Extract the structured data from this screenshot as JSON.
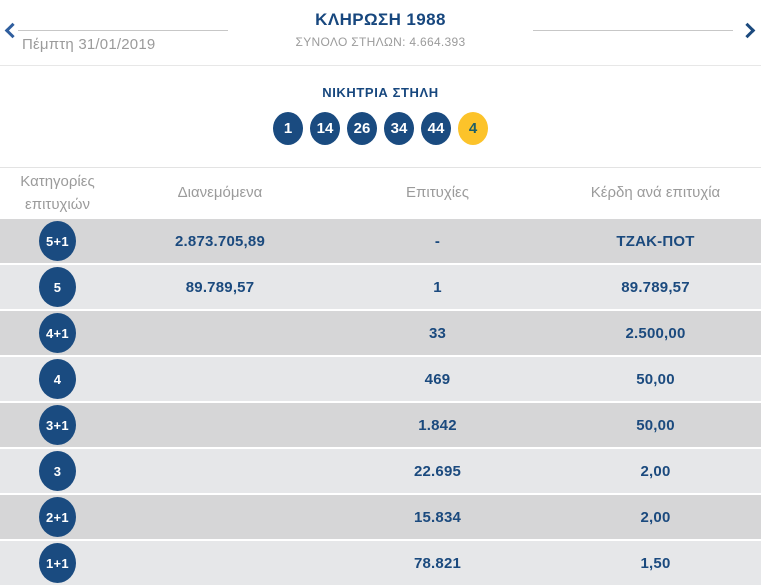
{
  "header": {
    "title": "ΚΛΗΡΩΣΗ 1988",
    "total_columns": "ΣΥΝΟΛΟ ΣΤΗΛΩΝ: 4.664.393",
    "date": "Πέμπτη 31/01/2019",
    "prev_icon": "chevron-left",
    "next_icon": "chevron-right"
  },
  "winning_column": {
    "title": "ΝΙΚΗΤΡΙΑ ΣΤΗΛΗ",
    "numbers": [
      "1",
      "14",
      "26",
      "34",
      "44"
    ],
    "joker": "4"
  },
  "results_table": {
    "columns": [
      "Κατηγορίες επιτυχιών",
      "Διανεμόμενα",
      "Επιτυχίες",
      "Κέρδη ανά επιτυχία"
    ],
    "rows": [
      {
        "category": "5+1",
        "distributed": "2.873.705,89",
        "winners": "-",
        "prize": "ΤΖΑΚ-ΠΟΤ"
      },
      {
        "category": "5",
        "distributed": "89.789,57",
        "winners": "1",
        "prize": "89.789,57"
      },
      {
        "category": "4+1",
        "distributed": "",
        "winners": "33",
        "prize": "2.500,00"
      },
      {
        "category": "4",
        "distributed": "",
        "winners": "469",
        "prize": "50,00"
      },
      {
        "category": "3+1",
        "distributed": "",
        "winners": "1.842",
        "prize": "50,00"
      },
      {
        "category": "3",
        "distributed": "",
        "winners": "22.695",
        "prize": "2,00"
      },
      {
        "category": "2+1",
        "distributed": "",
        "winners": "15.834",
        "prize": "2,00"
      },
      {
        "category": "1+1",
        "distributed": "",
        "winners": "78.821",
        "prize": "1,50"
      }
    ]
  },
  "colors": {
    "brand_blue": "#1a4b80",
    "joker_yellow": "#fcc32a",
    "joker_text": "#1d5f66",
    "muted_gray_text": "#9b9b9b",
    "row_light": "#e6e7e9",
    "row_dark": "#d6d6d7"
  }
}
